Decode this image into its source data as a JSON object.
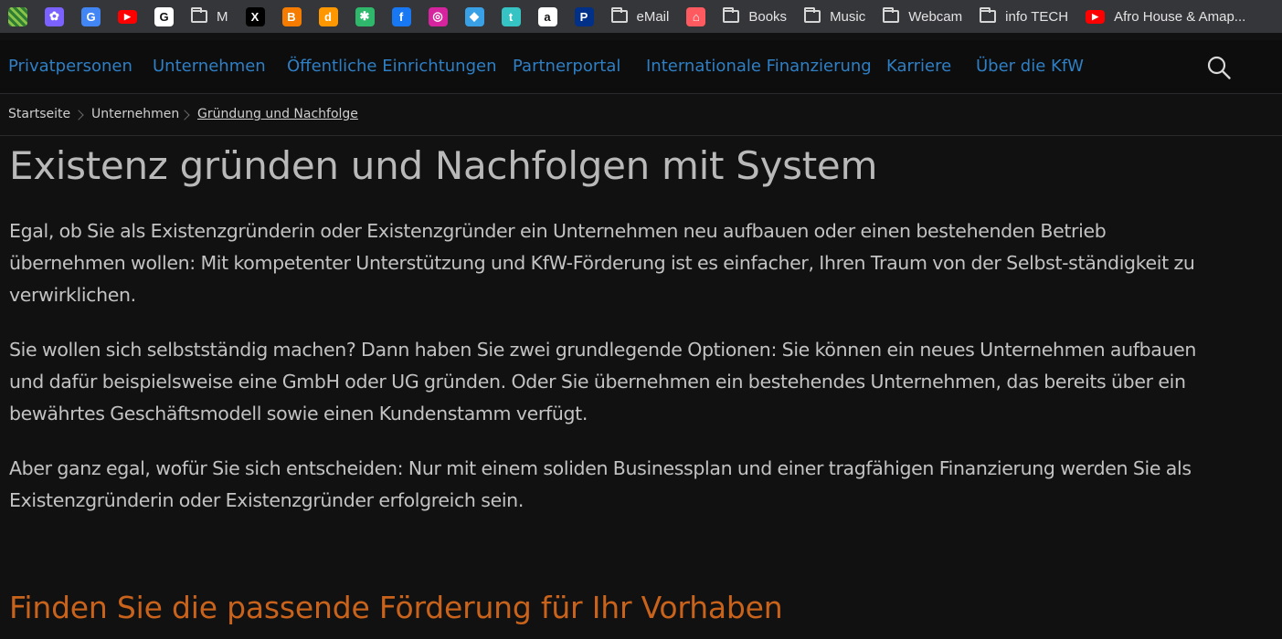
{
  "bookmarks": [
    {
      "kind": "icon",
      "icon": "mosaic-icon",
      "glyph": "",
      "color": "#2e7d32"
    },
    {
      "kind": "icon",
      "icon": "butterfly-icon",
      "glyph": "✿",
      "color": "#7b61ff"
    },
    {
      "kind": "icon",
      "icon": "google-translate-icon",
      "glyph": "G",
      "color": "#4285f4"
    },
    {
      "kind": "icon",
      "icon": "youtube-icon",
      "glyph": "▶",
      "color": "#ff0000"
    },
    {
      "kind": "icon",
      "icon": "google-icon",
      "glyph": "G",
      "color": "#ffffff"
    },
    {
      "kind": "folder",
      "icon": "folder-icon",
      "label": "M"
    },
    {
      "kind": "icon",
      "icon": "x-icon",
      "glyph": "X",
      "color": "#000000"
    },
    {
      "kind": "icon",
      "icon": "blogger-icon",
      "glyph": "B",
      "color": "#f57c00"
    },
    {
      "kind": "icon",
      "icon": "dailymotion-icon",
      "glyph": "d",
      "color": "#ff9800"
    },
    {
      "kind": "icon",
      "icon": "asterisk-icon",
      "glyph": "✱",
      "color": "#2fb86b"
    },
    {
      "kind": "icon",
      "icon": "facebook-icon",
      "glyph": "f",
      "color": "#1877f2"
    },
    {
      "kind": "icon",
      "icon": "instagram-icon",
      "glyph": "◎",
      "color": "#d6249f"
    },
    {
      "kind": "icon",
      "icon": "app-icon",
      "glyph": "◆",
      "color": "#3aa0e6"
    },
    {
      "kind": "icon",
      "icon": "tumblr-icon",
      "glyph": "t",
      "color": "#35c3c3"
    },
    {
      "kind": "icon",
      "icon": "amazon-icon",
      "glyph": "a",
      "color": "#ffffff"
    },
    {
      "kind": "icon",
      "icon": "paypal-icon",
      "glyph": "P",
      "color": "#003087"
    },
    {
      "kind": "folder",
      "icon": "folder-icon",
      "label": "eMail"
    },
    {
      "kind": "icon",
      "icon": "airbnb-icon",
      "glyph": "⌂",
      "color": "#ff5a5f"
    },
    {
      "kind": "folder",
      "icon": "folder-icon",
      "label": "Books"
    },
    {
      "kind": "folder",
      "icon": "folder-icon",
      "label": "Music"
    },
    {
      "kind": "folder",
      "icon": "folder-icon",
      "label": "Webcam"
    },
    {
      "kind": "folder",
      "icon": "folder-icon",
      "label": "info TECH"
    },
    {
      "kind": "youtube",
      "icon": "youtube-icon",
      "glyph": "▶",
      "color": "#ff0000",
      "label": "Afro House & Amap..."
    }
  ],
  "nav": {
    "items": [
      "Privatpersonen",
      "Unternehmen",
      "Öffentliche Einrichtungen",
      "Partnerportal",
      "Internationale Finanzierung",
      "Karriere",
      "Über die KfW"
    ],
    "link_color": "#2f7fc4"
  },
  "breadcrumb": [
    "Startseite",
    "Unternehmen",
    "Gründung und Nachfolge"
  ],
  "page": {
    "title": "Existenz gründen und Nachfolgen mit System",
    "paragraphs": [
      "Egal, ob Sie als Existenzgründerin oder Existenzgründer ein Unternehmen neu aufbauen oder einen bestehenden Betrieb übernehmen wollen: Mit kompetenter Unterstützung und KfW-Förderung ist es einfacher, Ihren Traum von der Selbst-ständigkeit zu verwirklichen.",
      "Sie wollen sich selbstständig machen? Dann haben Sie zwei grundlegende Optionen: Sie können ein neues Unternehmen aufbauen und dafür beispielsweise eine GmbH oder UG gründen. Oder Sie übernehmen ein bestehendes Unternehmen, das bereits über ein bewährtes Geschäftsmodell sowie einen Kundenstamm verfügt.",
      "Aber ganz egal, wofür Sie sich entscheiden: Nur mit einem soliden Businessplan und einer tragfähigen Finanzierung werden Sie als Existenzgründerin oder Existenzgründer erfolgreich sein."
    ],
    "section_heading": "Finden Sie die passende Förderung für Ihr Vorhaben",
    "accent_color": "#c9631b"
  }
}
